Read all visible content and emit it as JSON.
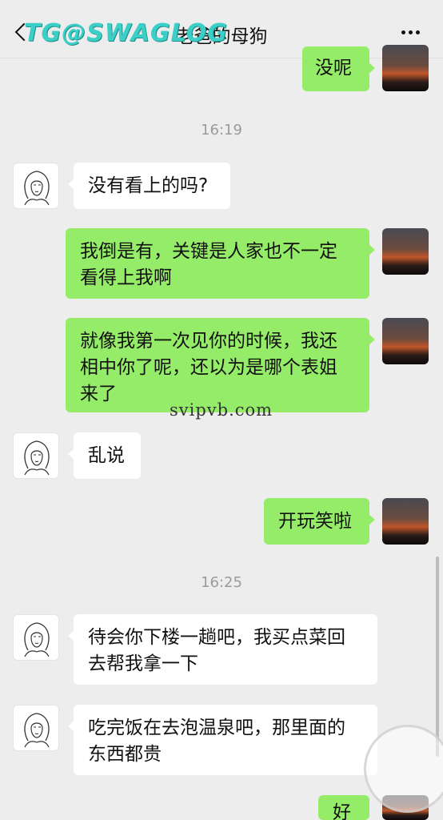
{
  "header": {
    "title": "老爸的母狗",
    "watermark": "TG@SWAGLOG"
  },
  "watermark_mid": "svipvb.com",
  "messages": [
    {
      "sender": "self",
      "text": "没呢"
    },
    {
      "type": "time",
      "text": "16:19"
    },
    {
      "sender": "friend",
      "text": "没有看上的吗?"
    },
    {
      "sender": "self",
      "text": "我倒是有，关键是人家也不一定看得上我啊"
    },
    {
      "sender": "self",
      "text": "就像我第一次见你的时候，我还相中你了呢，还以为是哪个表姐来了"
    },
    {
      "sender": "friend",
      "text": "乱说"
    },
    {
      "sender": "self",
      "text": "开玩笑啦"
    },
    {
      "type": "time",
      "text": "16:25"
    },
    {
      "sender": "friend",
      "text": "待会你下楼一趟吧，我买点菜回去帮我拿一下"
    },
    {
      "sender": "friend",
      "text": "吃完饭在去泡温泉吧，那里面的东西都贵"
    },
    {
      "sender": "self",
      "text": "好"
    }
  ],
  "icons": {
    "back": "chevron-left-icon",
    "more": "more-dots-icon",
    "friend_avatar": "line-drawing-woman-avatar",
    "self_avatar": "sunset-avatar"
  },
  "colors": {
    "background": "#ededed",
    "self_bubble": "#95ec69",
    "friend_bubble": "#ffffff",
    "watermark": "#3ccfc8"
  }
}
